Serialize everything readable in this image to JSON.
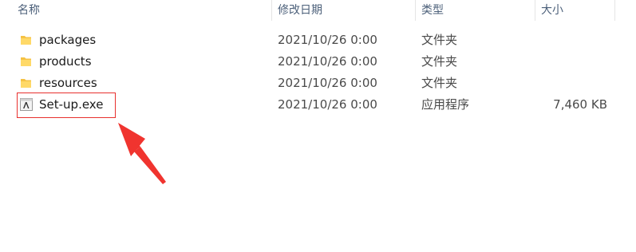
{
  "columns": {
    "name": "名称",
    "date": "修改日期",
    "type": "类型",
    "size": "大小"
  },
  "files": [
    {
      "name": "packages",
      "date": "2021/10/26 0:00",
      "type": "文件夹",
      "size": "",
      "icon": "folder-icon"
    },
    {
      "name": "products",
      "date": "2021/10/26 0:00",
      "type": "文件夹",
      "size": "",
      "icon": "folder-icon"
    },
    {
      "name": "resources",
      "date": "2021/10/26 0:00",
      "type": "文件夹",
      "size": "",
      "icon": "folder-icon"
    },
    {
      "name": "Set-up.exe",
      "date": "2021/10/26 0:00",
      "type": "应用程序",
      "size": "7,460 KB",
      "icon": "adobe-app-icon"
    }
  ],
  "annotation": {
    "highlight_color": "#e8302e",
    "target": "Set-up.exe"
  },
  "colors": {
    "header_text": "#4c607a",
    "folder": "#f5c244"
  }
}
